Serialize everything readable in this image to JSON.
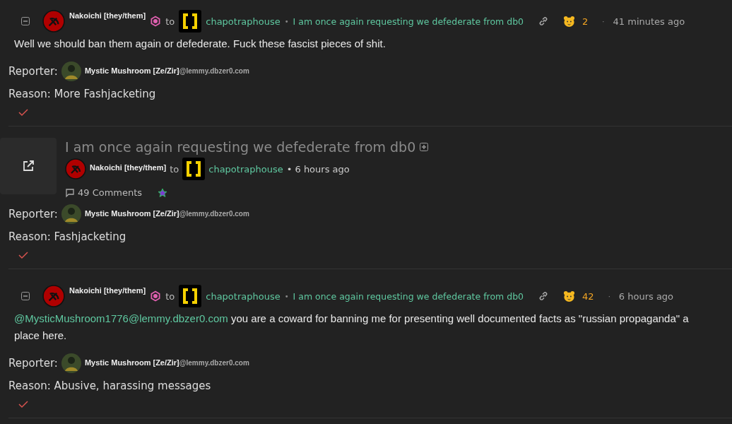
{
  "reports": [
    {
      "kind": "comment",
      "author": "Nakoichi [they/them]",
      "to": "to",
      "community": "chapotraphouse",
      "separator": "•",
      "post_title": "I am once again requesting we defederate from db0",
      "score": "2",
      "time_separator": "·",
      "time": "41 minutes ago",
      "body": [
        {
          "text": "Well we should ban them again or defederate. Fuck these fascist pieces of shit."
        }
      ],
      "reporter_label": "Reporter:",
      "reporter": "Mystic Mushroom [Ze/Zir]",
      "reporter_instance": "@lemmy.dbzer0.com",
      "reason": "Reason: More Fashjacketing"
    },
    {
      "kind": "post",
      "title": "I am once again requesting we defederate from db0",
      "author": "Nakoichi [they/them]",
      "to": "to",
      "community": "chapotraphouse",
      "time": "• 6 hours ago",
      "comments": "49 Comments",
      "reporter_label": "Reporter:",
      "reporter": "Mystic Mushroom [Ze/Zir]",
      "reporter_instance": "@lemmy.dbzer0.com",
      "reason": "Reason: Fashjacketing"
    },
    {
      "kind": "comment",
      "author": "Nakoichi [they/them]",
      "to": "to",
      "community": "chapotraphouse",
      "separator": "•",
      "post_title": "I am once again requesting we defederate from db0",
      "score": "42",
      "time_separator": "·",
      "time": "6 hours ago",
      "body": [
        {
          "mention": "@MysticMushroom1776@lemmy.dbzer0.com",
          "text": " you are a coward for banning me for presenting well documented facts as \"russian propaganda\" a"
        },
        {
          "text": "place here."
        }
      ],
      "reporter_label": "Reporter:",
      "reporter": "Mystic Mushroom [Ze/Zir]",
      "reporter_instance": "@lemmy.dbzer0.com",
      "reason": "Reason: Abusive, harassing messages"
    }
  ]
}
